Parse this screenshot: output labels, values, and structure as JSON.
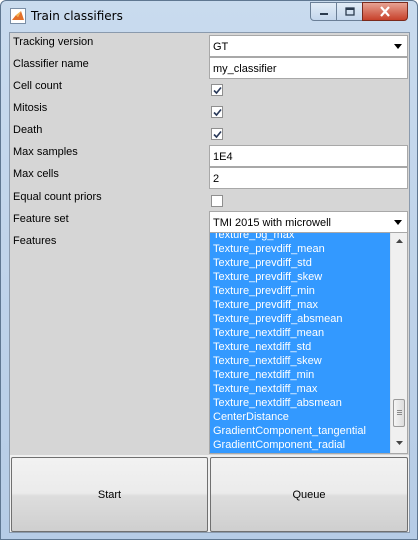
{
  "window": {
    "title": "Train classifiers"
  },
  "form": {
    "tracking_version": {
      "label": "Tracking version",
      "value": "GT"
    },
    "classifier_name": {
      "label": "Classifier name",
      "value": "my_classifier"
    },
    "cell_count": {
      "label": "Cell count",
      "checked": true
    },
    "mitosis": {
      "label": "Mitosis",
      "checked": true
    },
    "death": {
      "label": "Death",
      "checked": true
    },
    "max_samples": {
      "label": "Max samples",
      "value": "1E4"
    },
    "max_cells": {
      "label": "Max cells",
      "value": "2"
    },
    "equal_count_priors": {
      "label": "Equal count priors",
      "checked": false
    },
    "feature_set": {
      "label": "Feature set",
      "value": "TMI 2015 with microwell"
    },
    "features": {
      "label": "Features",
      "items": [
        "Texture_bg_max",
        "Texture_prevdiff_mean",
        "Texture_prevdiff_std",
        "Texture_prevdiff_skew",
        "Texture_prevdiff_min",
        "Texture_prevdiff_max",
        "Texture_prevdiff_absmean",
        "Texture_nextdiff_mean",
        "Texture_nextdiff_std",
        "Texture_nextdiff_skew",
        "Texture_nextdiff_min",
        "Texture_nextdiff_max",
        "Texture_nextdiff_absmean",
        "CenterDistance",
        "GradientComponent_tangential",
        "GradientComponent_radial"
      ]
    }
  },
  "buttons": {
    "start": "Start",
    "queue": "Queue"
  },
  "colors": {
    "selection": "#3399ff",
    "close_button": "#c7412b",
    "panel": "#d6d6d6"
  }
}
